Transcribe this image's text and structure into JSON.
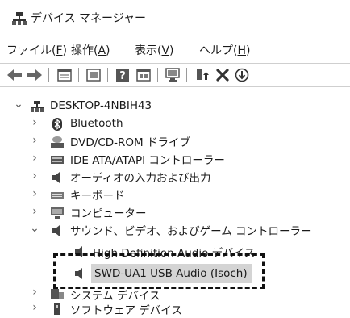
{
  "window": {
    "title": "デバイス マネージャー"
  },
  "menu": {
    "file": {
      "text": "ファイル(",
      "key": "F",
      "end": ")"
    },
    "action": {
      "text": "操作(",
      "key": "A",
      "end": ")"
    },
    "view": {
      "text": "表示(",
      "key": "V",
      "end": ")"
    },
    "help": {
      "text": "ヘルプ(",
      "key": "H",
      "end": ")"
    }
  },
  "toolbar": {
    "icons": [
      "back-arrow-icon",
      "forward-arrow-icon",
      "properties-icon",
      "devices-view-icon",
      "help-icon",
      "console-tree-icon",
      "scan-hardware-icon",
      "update-driver-icon",
      "uninstall-icon",
      "enable-device-icon"
    ]
  },
  "tree": {
    "root": "DESKTOP-4NBIH43",
    "items": [
      {
        "label": "Bluetooth",
        "icon": "bluetooth-icon"
      },
      {
        "label": "DVD/CD-ROM ドライブ",
        "icon": "disc-drive-icon"
      },
      {
        "label": "IDE ATA/ATAPI コントローラー",
        "icon": "ide-controller-icon"
      },
      {
        "label": "オーディオの入力および出力",
        "icon": "speaker-icon"
      },
      {
        "label": "キーボード",
        "icon": "keyboard-icon"
      },
      {
        "label": "コンピューター",
        "icon": "computer-icon"
      },
      {
        "label": "サウンド、ビデオ、およびゲーム コントローラー",
        "icon": "speaker-icon",
        "expanded": true
      },
      {
        "label": "High Definition Audio デバイス",
        "icon": "speaker-icon",
        "child": true
      },
      {
        "label": "SWD-UA1 USB Audio (Isoch)",
        "icon": "speaker-icon",
        "child": true,
        "selected": true
      },
      {
        "label": "システム デバイス",
        "icon": "system-device-icon"
      },
      {
        "label": "ソフトウェア デバイス",
        "icon": "software-device-icon"
      }
    ]
  },
  "colors": {
    "selection": "#d4d4d4",
    "highlight_box": "#111111"
  }
}
